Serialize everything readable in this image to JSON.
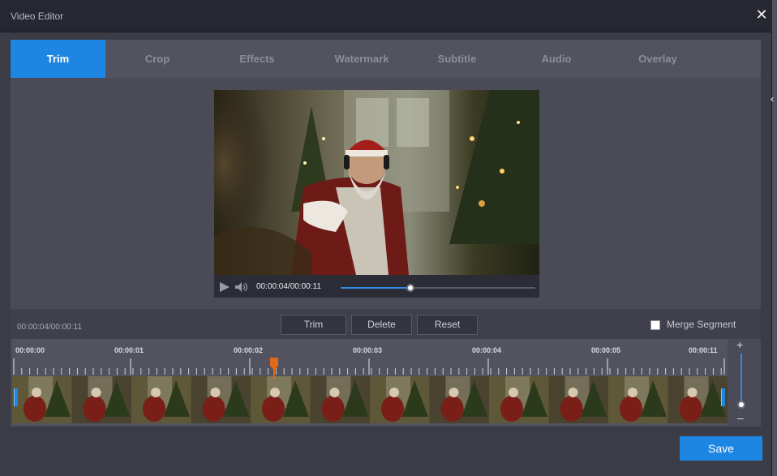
{
  "window": {
    "title": "Video Editor",
    "close_icon": "close-icon"
  },
  "tabs": [
    {
      "label": "Trim",
      "active": true
    },
    {
      "label": "Crop",
      "active": false
    },
    {
      "label": "Effects",
      "active": false
    },
    {
      "label": "Watermark",
      "active": false
    },
    {
      "label": "Subtitle",
      "active": false
    },
    {
      "label": "Audio",
      "active": false
    },
    {
      "label": "Overlay",
      "active": false
    }
  ],
  "player": {
    "time": "00:00:04/00:00:11",
    "progress": 0.36,
    "icons": [
      "play-icon",
      "volume-icon"
    ]
  },
  "trim_toolbar": {
    "current_time": "00:00:04/00:00:11",
    "trim_label": "Trim",
    "delete_label": "Delete",
    "reset_label": "Reset",
    "merge_label": "Merge Segment",
    "merge_checked": false
  },
  "timeline": {
    "tick_labels": [
      "00:00:00",
      "00:00:01",
      "00:00:02",
      "00:00:03",
      "00:00:04",
      "00:00:05",
      "00:00:11"
    ],
    "zoom_plus": "+",
    "zoom_minus": "–"
  },
  "save_label": "Save",
  "colors": {
    "accent": "#1d86e3",
    "playhead": "#e06a1a",
    "background": "#3b3c46"
  }
}
